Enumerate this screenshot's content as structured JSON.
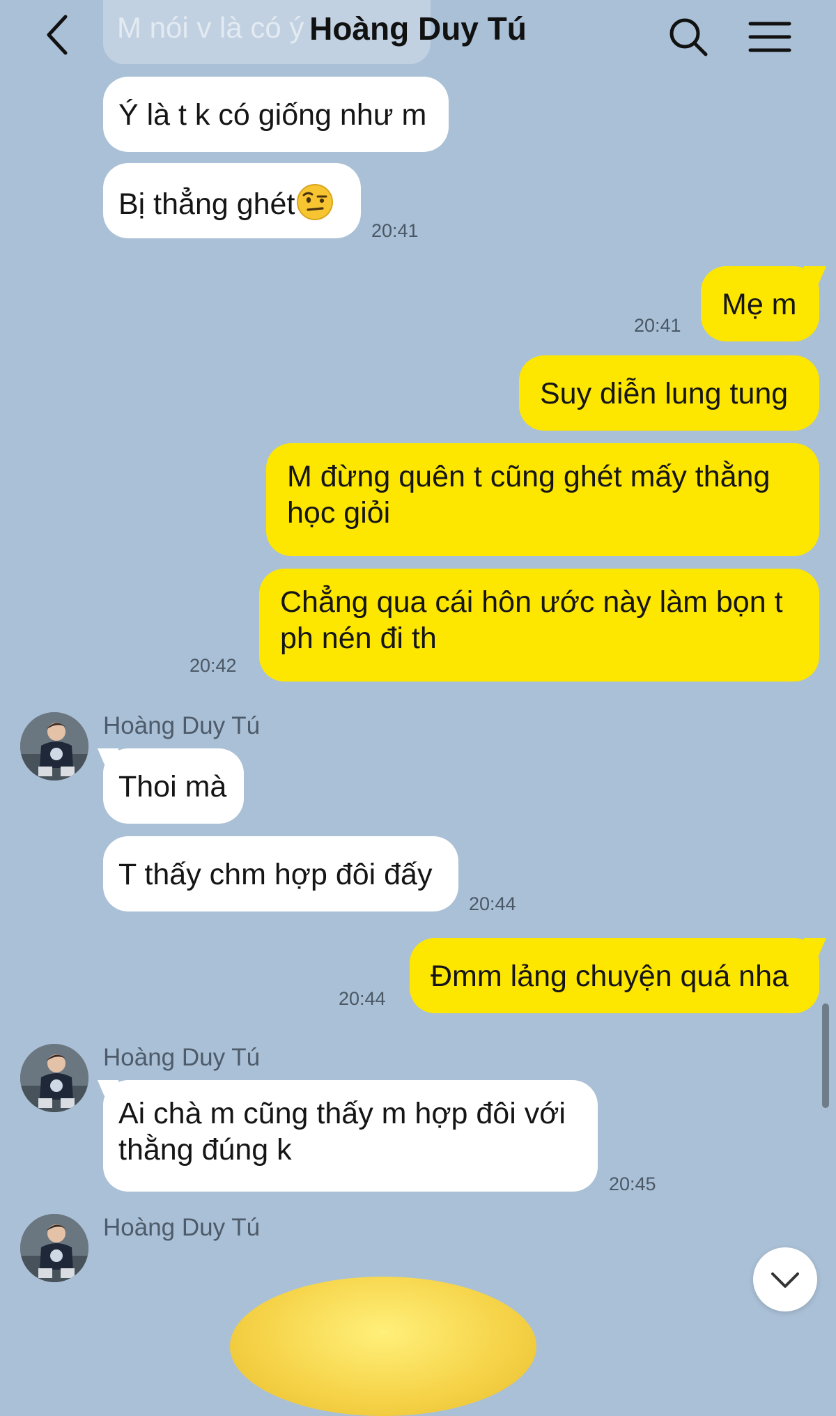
{
  "header": {
    "title": "Hoàng Duy Tú",
    "ghost_preview": "M nói v là có ý"
  },
  "messages": [
    {
      "text": "Ý là t k có giống như m"
    },
    {
      "text": "Bị thẳng ghét",
      "emoji": "face-with-raised-eyebrow",
      "time": "20:41"
    },
    {
      "text": "Mẹ m",
      "time": "20:41"
    },
    {
      "text": "Suy diễn lung tung"
    },
    {
      "text": "M đừng quên t cũng ghét mấy thằng học giỏi"
    },
    {
      "text": "Chẳng qua cái hôn ước này làm bọn t ph nén đi th",
      "time": "20:42"
    },
    {
      "sender": "Hoàng Duy Tú",
      "text": "Thoi mà"
    },
    {
      "text": "T thấy chm hợp đôi đấy",
      "time": "20:44"
    },
    {
      "text": "Đmm lảng chuyện quá nha",
      "time": "20:44"
    },
    {
      "sender": "Hoàng Duy Tú",
      "text": "Ai chà m cũng thấy m hợp đôi với thằng đúng k",
      "time": "20:45"
    },
    {
      "sender": "Hoàng Duy Tú",
      "sticker": "yellow-sticker"
    }
  ],
  "colors": {
    "background": "#aac0d6",
    "incoming_bubble": "#ffffff",
    "outgoing_bubble": "#fde600"
  },
  "icons": {
    "back": "chevron-left-icon",
    "search": "search-icon",
    "menu": "menu-icon",
    "scroll_down": "chevron-down-icon"
  }
}
